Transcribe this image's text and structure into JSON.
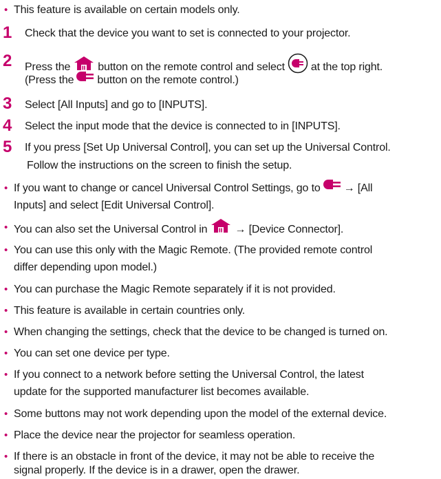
{
  "colors": {
    "accent": "#c6006b",
    "text": "#1a1a1a"
  },
  "icons": {
    "home": "home-icon",
    "input": "input-plug-icon",
    "arrow": "→"
  },
  "intro_note": "This feature is available on certain models only.",
  "steps": [
    {
      "number": "1",
      "text": "Check that the device you want to set is connected to your projector."
    },
    {
      "number": "2",
      "text_a": "Press the",
      "text_b": "button on the remote control and select",
      "text_c": "at the top right.",
      "text_d": "(Press the",
      "text_e": "button on the remote control.)"
    },
    {
      "number": "3",
      "text": "Select [All Inputs] and go to [INPUTS]."
    },
    {
      "number": "4",
      "text": "Select the input mode that the device is connected to in [INPUTS]."
    },
    {
      "number": "5",
      "line1": "If you press [Set Up Universal Control], you can set up the Universal Control.",
      "line2": "Follow the instructions on the screen to finish the setup."
    }
  ],
  "notes": {
    "n1_a": "If you want to change or cancel Universal Control Settings, go to",
    "n1_b": "→ [All",
    "n1_c": "Inputs] and select [Edit Universal Control].",
    "n2_a": "You can also set the Universal Control in",
    "n2_b": "→ [Device Connector].",
    "n3_a": "You can use this only with the Magic Remote. (The provided remote control",
    "n3_b": "differ depending upon model.)",
    "n4": "You can purchase the Magic Remote separately if it is not provided.",
    "n5": "This feature is available in certain countries only.",
    "n6": "When changing the settings, check that the device to be changed is turned on.",
    "n7": "You can set one device per type.",
    "n8_a": "If you connect to a network before setting the Universal Control, the latest",
    "n8_b": "update for the supported manufacturer list becomes available.",
    "n9": "Some buttons may not work depending upon the model of the external device.",
    "n10": "Place the device near the projector for seamless operation.",
    "n11_a": "If there is an obstacle in front of the device, it may not be able to receive the",
    "n11_b": "signal properly. If the device is in a drawer, open the drawer."
  }
}
